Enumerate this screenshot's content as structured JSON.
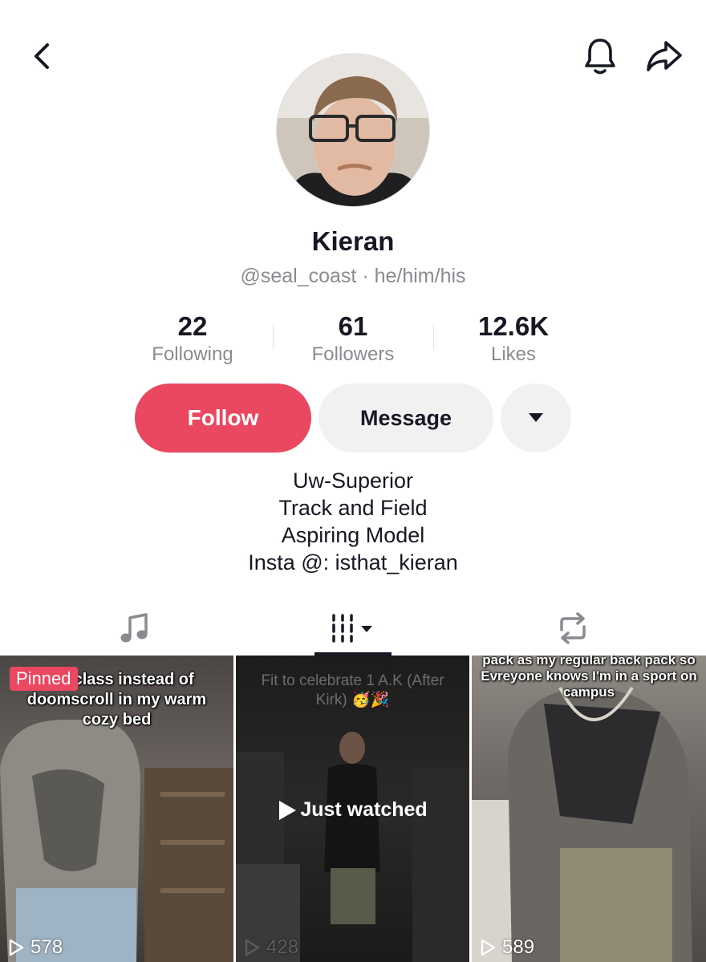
{
  "header": {
    "back_icon": "chevron-left-icon",
    "bell_icon": "bell-icon",
    "share_icon": "share-arrow-icon"
  },
  "profile": {
    "name": "Kieran",
    "handle": "@seal_coast",
    "separator": "·",
    "pronouns": "he/him/his",
    "avatar_icon": "profile-photo"
  },
  "stats": [
    {
      "value": "22",
      "label": "Following"
    },
    {
      "value": "61",
      "label": "Followers"
    },
    {
      "value": "12.6K",
      "label": "Likes"
    }
  ],
  "actions": {
    "follow_label": "Follow",
    "message_label": "Message",
    "more_icon": "caret-down-icon",
    "follow_color": "#ea4760"
  },
  "bio": [
    "Uw-Superior",
    "Track and Field",
    "Aspiring Model",
    "Insta @: isthat_kieran"
  ],
  "tabs": [
    {
      "icon": "music-note-icon",
      "active": false
    },
    {
      "icon": "video-grid-icon",
      "active": true
    },
    {
      "icon": "repost-icon",
      "active": false
    }
  ],
  "videos": [
    {
      "badge": "Pinned",
      "caption": "o to class instead of doomscroll in my warm cozy bed",
      "views": "578"
    },
    {
      "caption": "Fit to celebrate 1 A.K (After Kirk) 🥳🎉",
      "overlay": "Just watched",
      "views": "428"
    },
    {
      "caption": "pack as my regular back pack so Evreyone knows I'm in a sport on campus",
      "views": "589"
    }
  ]
}
